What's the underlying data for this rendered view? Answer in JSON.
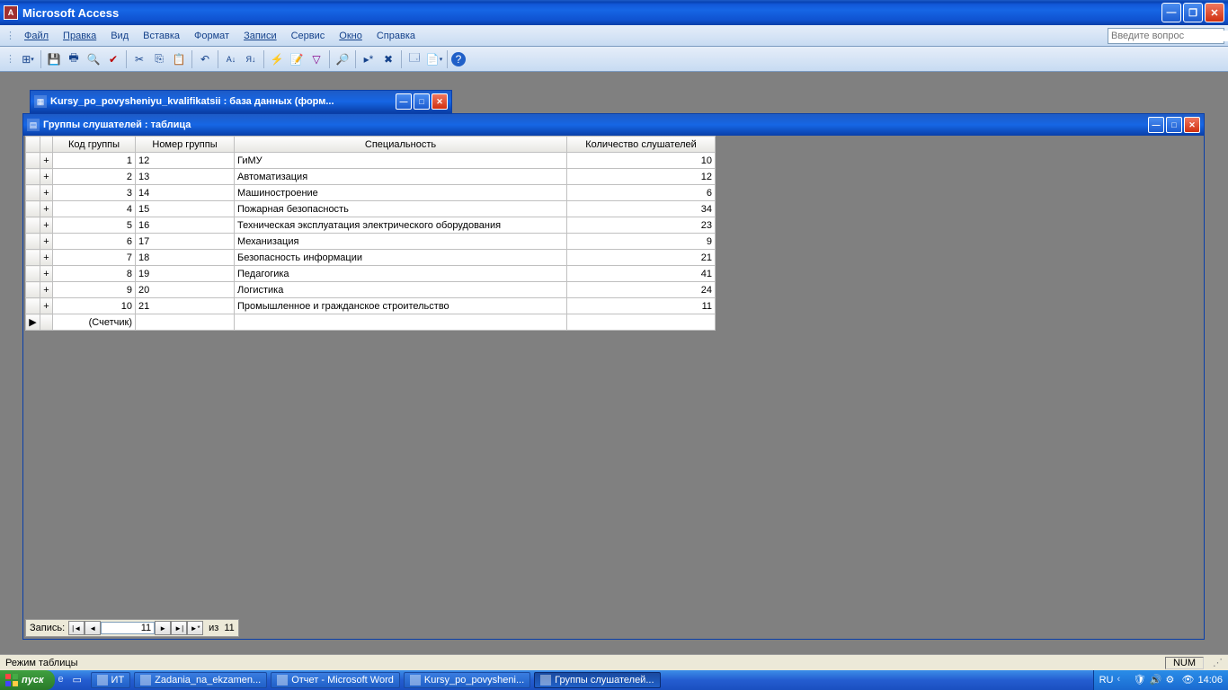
{
  "app": {
    "title": "Microsoft Access"
  },
  "menu": {
    "items": [
      "Файл",
      "Правка",
      "Вид",
      "Вставка",
      "Формат",
      "Записи",
      "Сервис",
      "Окно",
      "Справка"
    ],
    "help_placeholder": "Введите вопрос"
  },
  "db_window": {
    "title": "Kursy_po_povysheniyu_kvalifikatsii : база данных (форм..."
  },
  "table_window": {
    "title": "Группы слушателей : таблица"
  },
  "table": {
    "headers": [
      "Код группы",
      "Номер группы",
      "Специальность",
      "Количество слушателей"
    ],
    "rows": [
      {
        "code": "1",
        "num": "12",
        "spec": "ГиМУ",
        "qty": "10"
      },
      {
        "code": "2",
        "num": "13",
        "spec": "Автоматизация",
        "qty": "12"
      },
      {
        "code": "3",
        "num": "14",
        "spec": "Машиностроение",
        "qty": "6"
      },
      {
        "code": "4",
        "num": "15",
        "spec": "Пожарная безопасность",
        "qty": "34"
      },
      {
        "code": "5",
        "num": "16",
        "spec": "Техническая эксплуатация электрического оборудования",
        "qty": "23"
      },
      {
        "code": "6",
        "num": "17",
        "spec": "Механизация",
        "qty": "9"
      },
      {
        "code": "7",
        "num": "18",
        "spec": "Безопасность информации",
        "qty": "21"
      },
      {
        "code": "8",
        "num": "19",
        "spec": "Педагогика",
        "qty": "41"
      },
      {
        "code": "9",
        "num": "20",
        "spec": "Логистика",
        "qty": "24"
      },
      {
        "code": "10",
        "num": "21",
        "spec": "Промышленное и гражданское строительство",
        "qty": "11"
      }
    ],
    "autonum_label": "(Счетчик)"
  },
  "record_nav": {
    "label": "Запись:",
    "current": "11",
    "of_label": "из",
    "total": "11"
  },
  "statusbar": {
    "mode": "Режим таблицы",
    "num": "NUM"
  },
  "taskbar": {
    "start": "пуск",
    "items": [
      {
        "label": "ИТ"
      },
      {
        "label": "Zadania_na_ekzamen..."
      },
      {
        "label": "Отчет - Microsoft Word"
      },
      {
        "label": "Kursy_po_povysheni..."
      },
      {
        "label": "Группы слушателей..."
      }
    ],
    "lang": "RU",
    "time": "14:06"
  },
  "glyph": {
    "min": "—",
    "max": "□",
    "restore": "❐",
    "close": "✕",
    "first": "|◄",
    "prev": "◄",
    "next": "►",
    "last": "►|",
    "new": "►*",
    "dd": "▾",
    "current_row": "▶",
    "plus": "+"
  }
}
